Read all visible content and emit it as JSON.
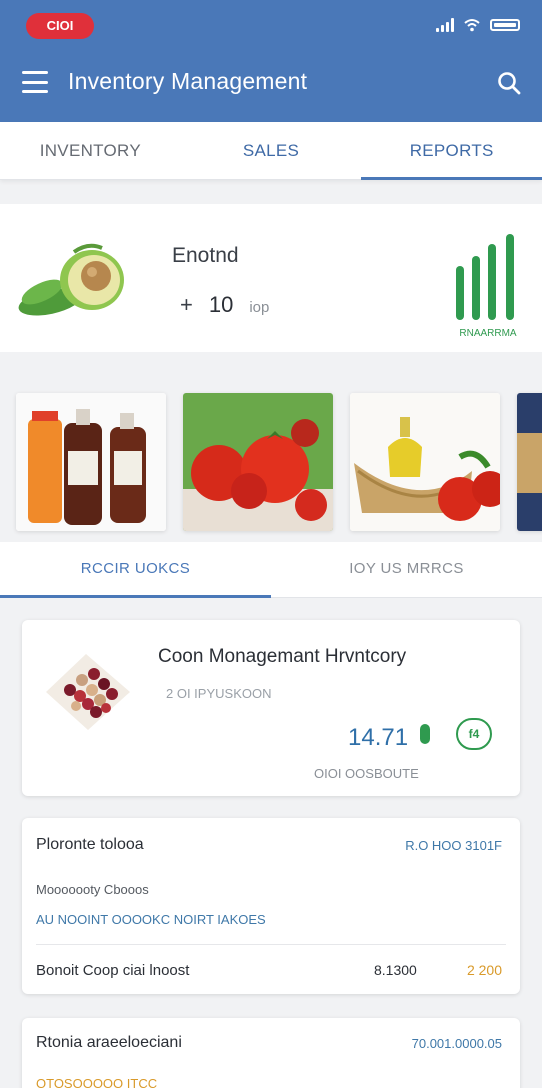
{
  "status_bar": {
    "pill_text": "CIOI"
  },
  "header": {
    "title": "Inventory Management"
  },
  "tabs": [
    {
      "label": "INVENTORY"
    },
    {
      "label": "SALES"
    },
    {
      "label": "REPORTS"
    }
  ],
  "summary": {
    "title": "Enotnd",
    "plus": "+",
    "quantity": "10",
    "unit": "iop",
    "chart_label": "RNAARRMA"
  },
  "subtabs": [
    {
      "label": "RCCIR UOKCS"
    },
    {
      "label": "IOY US MRRCS"
    }
  ],
  "feature": {
    "title": "Coon Monagemant Hrvntcory",
    "subtitle": "2 OI IPYUSKOON",
    "value": "14.71",
    "badge": "f4",
    "footer": "OIOI OOSBOUTE"
  },
  "list_items": [
    {
      "title": "Ploronte tolooa",
      "code": "R.O HOO 3101F",
      "line1": "Mooooooty Cbooos",
      "line2": "AU NOOINT OOOOKC NOIRT IAKOES",
      "footer": "Bonoit Coop ciai lnoost",
      "price": "8.1300",
      "price_alt": "2 200"
    },
    {
      "title": "Rtonia araeeloeciani",
      "code": "70.001.0000.05",
      "subtitle": "OTOSOOOOO ITCC"
    }
  ],
  "colors": {
    "appbar": "#4a78b8",
    "accent_green": "#2f9a4f",
    "accent_blue": "#3f78a8",
    "accent_orange": "#d99a2a",
    "status_pill": "#e0303a"
  }
}
